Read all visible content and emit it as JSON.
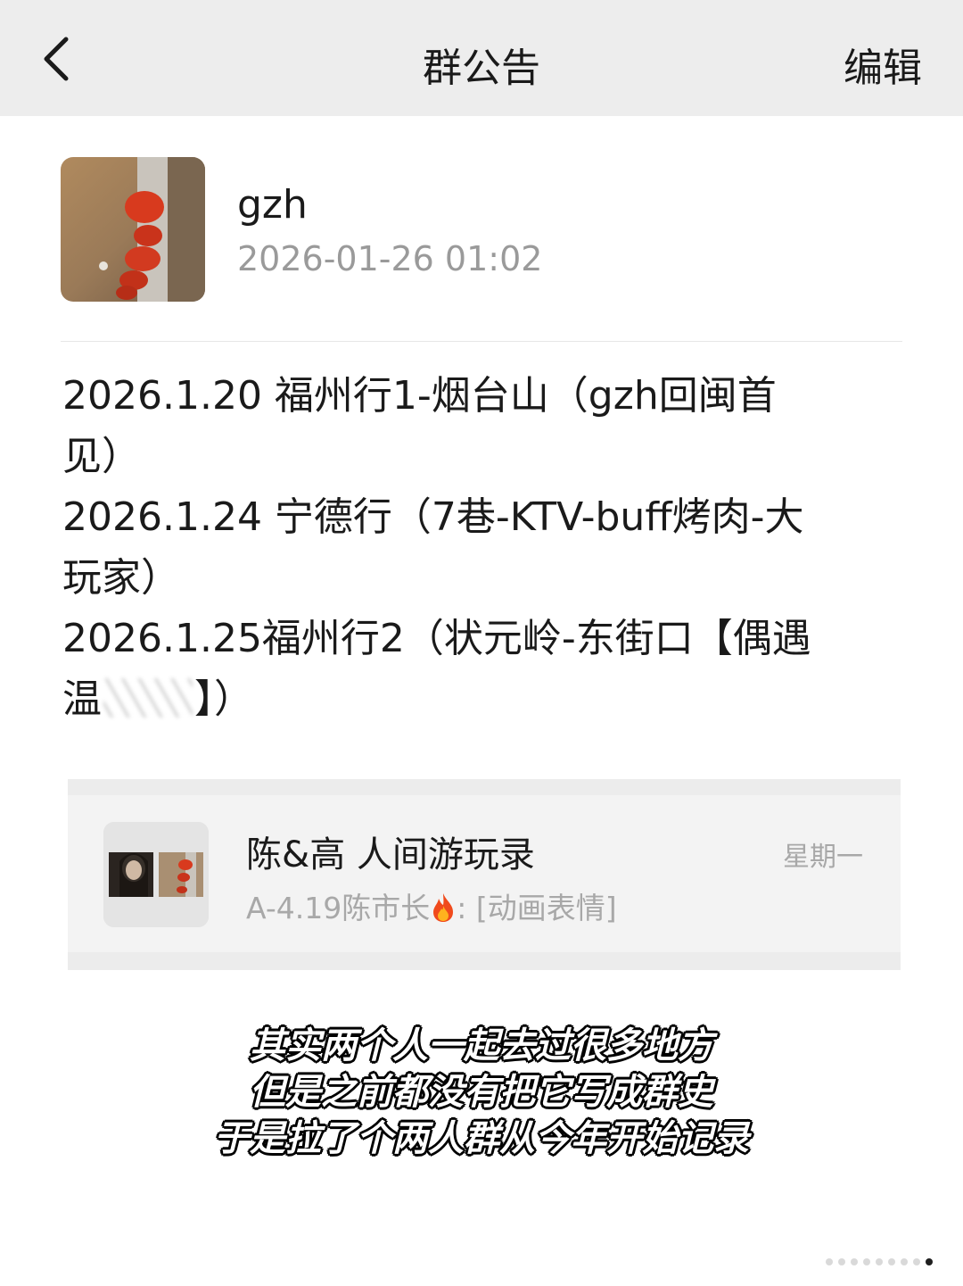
{
  "header": {
    "title": "群公告",
    "edit_label": "编辑",
    "back_icon": "chevron-left-icon"
  },
  "author": {
    "name": "gzh",
    "time": "2026-01-26 01:02"
  },
  "notice": {
    "lines": [
      "2026.1.20 福州行1-烟台山（gzh回闽首",
      "见）",
      "2026.1.24 宁德行（7巷-KTV-buff烤肉-大",
      "玩家）",
      "2026.1.25福州行2（状元岭-东街口【偶遇",
      "温",
      "】）"
    ]
  },
  "chat_card": {
    "title": "陈&高 人间游玩录",
    "day": "星期一",
    "msg_prefix": "A-4.19陈市长",
    "msg_suffix": ": [动画表情]",
    "emoji_icon": "fire-emoji-icon"
  },
  "caption": {
    "lines": [
      "其实两个人一起去过很多地方",
      "但是之前都没有把它写成群史",
      "于是拉了个两人群从今年开始记录"
    ]
  },
  "pagination": {
    "count": 9,
    "active": 9
  },
  "colors": {
    "topbar_bg": "#ededed",
    "muted_text": "#9a9a9a",
    "card_bg": "#f3f3f3"
  }
}
